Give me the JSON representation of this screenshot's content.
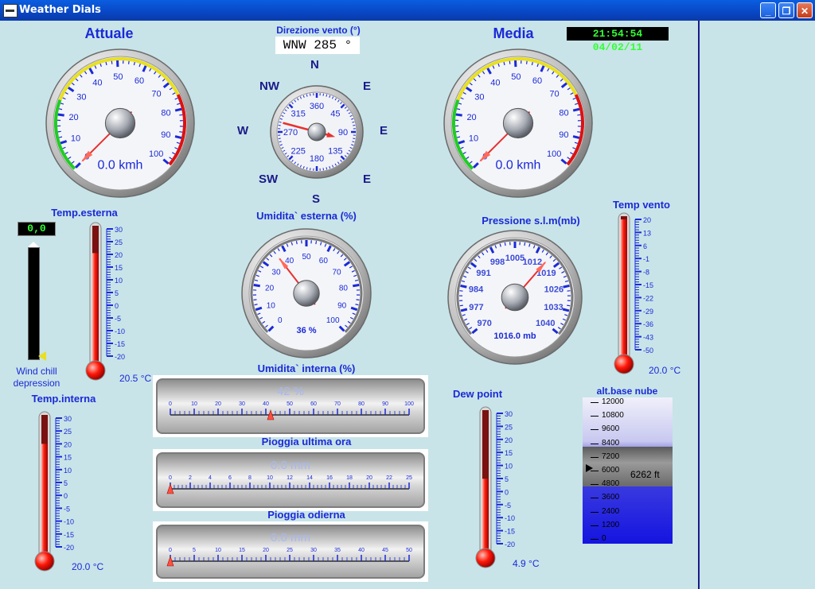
{
  "window": {
    "title": "Weather Dials",
    "min_label": "_",
    "max_label": "❐",
    "close_label": "✕"
  },
  "clock": "21:54:54 04/02/11",
  "wind": {
    "actual": {
      "title": "Attuale",
      "reading": "0.0 kmh",
      "value": 0,
      "ticks": [
        "0",
        "10",
        "20",
        "30",
        "40",
        "50",
        "60",
        "70",
        "80",
        "90",
        "100"
      ]
    },
    "average": {
      "title": "Media",
      "reading": "0.0 kmh",
      "value": 0,
      "ticks": [
        "0",
        "10",
        "20",
        "30",
        "40",
        "50",
        "60",
        "70",
        "80",
        "90",
        "100"
      ]
    },
    "direction": {
      "title": "Direzione vento (°)",
      "readout": "WNW  285 °",
      "degrees": 285,
      "compass": {
        "N": "N",
        "NW": "NW",
        "NE": "E",
        "W": "W",
        "E": "E",
        "SW": "SW",
        "SE": "E",
        "S": "S"
      },
      "ticks": [
        "360",
        "45",
        "90",
        "135",
        "180",
        "225",
        "270",
        "315"
      ]
    }
  },
  "humidity_out": {
    "title": "Umidita` esterna (%)",
    "reading": "36 %",
    "value": 36,
    "ticks": [
      "0",
      "10",
      "20",
      "30",
      "40",
      "50",
      "60",
      "70",
      "80",
      "90",
      "100"
    ]
  },
  "pressure": {
    "title": "Pressione s.l.m(mb)",
    "reading": "1016.0 mb",
    "value": 1016,
    "ticks": [
      "970",
      "977",
      "984",
      "991",
      "998",
      "1005",
      "1012",
      "1019",
      "1026",
      "1033",
      "1040"
    ]
  },
  "temp_out": {
    "title": "Temp.esterna",
    "reading": "20.5 °C",
    "value": 20.5,
    "ticks": [
      "30",
      "25",
      "20",
      "15",
      "10",
      "5",
      "0",
      "-5",
      "-10",
      "-15",
      "-20"
    ]
  },
  "temp_in": {
    "title": "Temp.interna",
    "reading": "20.0 °C",
    "value": 20.0,
    "ticks": [
      "30",
      "25",
      "20",
      "15",
      "10",
      "5",
      "0",
      "-5",
      "-10",
      "-15",
      "-20"
    ]
  },
  "dew_point": {
    "title": "Dew point",
    "reading": "4.9 °C",
    "value": 4.9,
    "ticks": [
      "30",
      "25",
      "20",
      "15",
      "10",
      "5",
      "0",
      "-5",
      "-10",
      "-15",
      "-20"
    ]
  },
  "temp_wind": {
    "title": "Temp vento",
    "reading": "20.0 °C",
    "value": 20.0,
    "ticks": [
      "20",
      "13",
      "6",
      "-1",
      "-8",
      "-15",
      "-22",
      "-29",
      "-36",
      "-43",
      "-50"
    ]
  },
  "wind_chill": {
    "digit": "0,0",
    "label": "Wind chill\ndepression",
    "value": 0
  },
  "humidity_in": {
    "title": "Umidita` interna (%)",
    "reading": "42 %",
    "value": 42,
    "ticks": [
      "0",
      "10",
      "20",
      "30",
      "40",
      "50",
      "60",
      "70",
      "80",
      "90",
      "100"
    ]
  },
  "rain_hour": {
    "title": "Pioggia ultima ora",
    "reading": "0.0 mm",
    "value": 0,
    "ticks": [
      "0",
      "2",
      "4",
      "6",
      "8",
      "10",
      "12",
      "14",
      "16",
      "18",
      "20",
      "22",
      "25"
    ]
  },
  "rain_day": {
    "title": "Pioggia odierna",
    "reading": "0.0 mm",
    "value": 0,
    "ticks": [
      "0",
      "5",
      "10",
      "15",
      "20",
      "25",
      "30",
      "35",
      "40",
      "45",
      "50"
    ]
  },
  "cloud_base": {
    "title": "alt.base nube",
    "reading": "6262 ft",
    "value": 6262,
    "ticks": [
      "12000",
      "10800",
      "9600",
      "8400",
      "7200",
      "6000",
      "4800",
      "3600",
      "2400",
      "1200",
      "0"
    ]
  },
  "colors": {
    "label": "#1a2ad8",
    "needle": "#e83030",
    "mercury": "#e81010"
  }
}
